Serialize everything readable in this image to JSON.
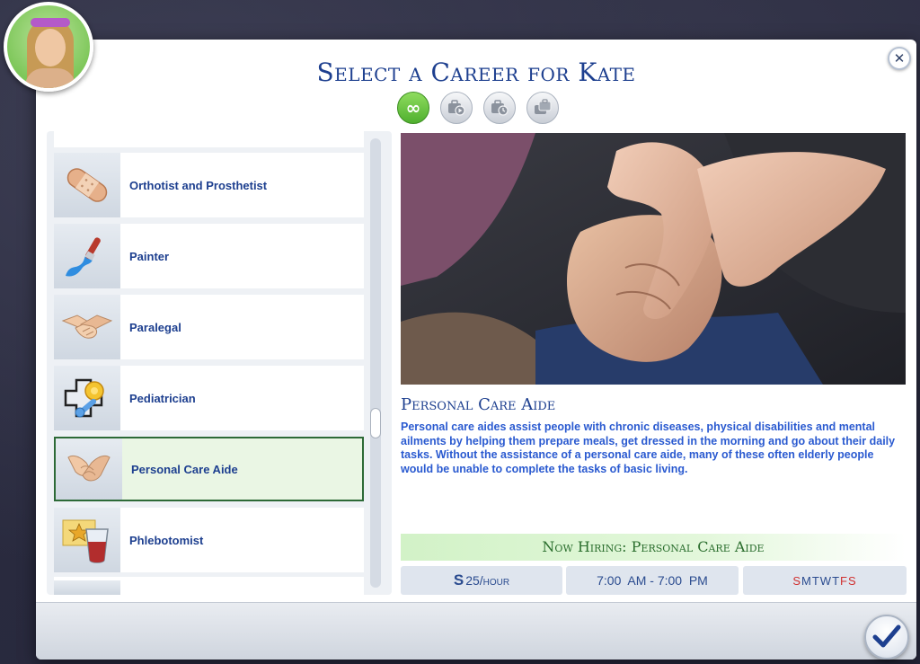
{
  "title": "Select a Career for Kate",
  "filters": [
    {
      "name": "all-careers",
      "glyph": "∞",
      "active": true
    },
    {
      "name": "part-time",
      "glyph": "",
      "active": false
    },
    {
      "name": "full-time",
      "glyph": "",
      "active": false
    },
    {
      "name": "freelance",
      "glyph": "",
      "active": false
    }
  ],
  "careers": [
    {
      "label": "Orthotist and Prosthetist",
      "icon": "bandage-icon",
      "selected": false
    },
    {
      "label": "Painter",
      "icon": "paintbrush-icon",
      "selected": false
    },
    {
      "label": "Paralegal",
      "icon": "handshake-icon",
      "selected": false
    },
    {
      "label": "Pediatrician",
      "icon": "baby-rattle-icon",
      "selected": false
    },
    {
      "label": "Personal Care Aide",
      "icon": "holding-hands-icon",
      "selected": true
    },
    {
      "label": "Phlebotomist",
      "icon": "blood-vial-icon",
      "selected": false
    }
  ],
  "detail": {
    "name": "Personal Care Aide",
    "description": "Personal care aides assist people with chronic diseases, physical disabilities and mental ailments by helping them prepare meals, get dressed in the morning and go about their daily tasks. Without the assistance of a personal care aide, many of these often elderly people would be unable to complete the tasks of basic living.",
    "hiring": "Now Hiring: Personal Care Aide",
    "pay_symbol": "S",
    "pay_value": "25/hour",
    "hours": "7:00  AM - 7:00  PM",
    "days": [
      {
        "letter": "S",
        "work": true
      },
      {
        "letter": "M",
        "work": false
      },
      {
        "letter": "T",
        "work": false
      },
      {
        "letter": "W",
        "work": false
      },
      {
        "letter": "T",
        "work": false
      },
      {
        "letter": "F",
        "work": true
      },
      {
        "letter": "S",
        "work": true
      }
    ]
  },
  "colors": {
    "title": "#1d3f8f",
    "description": "#2a5ad0",
    "hiring_text": "#2b6e2e",
    "work_day": "#d03030",
    "selected_border": "#2d6a37"
  }
}
